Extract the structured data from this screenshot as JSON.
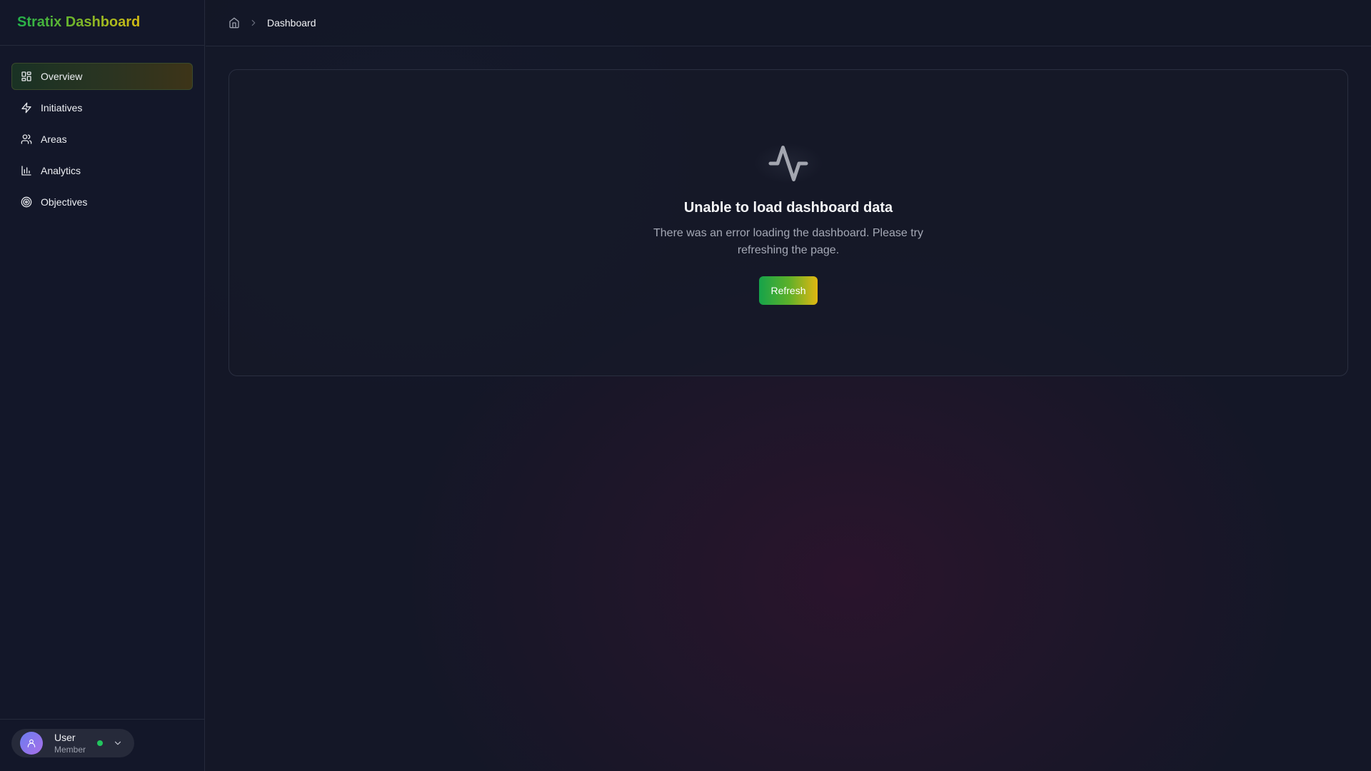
{
  "app": {
    "title": "Stratix Dashboard"
  },
  "sidebar": {
    "items": [
      {
        "label": "Overview",
        "icon": "layout-grid-icon",
        "active": true
      },
      {
        "label": "Initiatives",
        "icon": "zap-icon",
        "active": false
      },
      {
        "label": "Areas",
        "icon": "users-icon",
        "active": false
      },
      {
        "label": "Analytics",
        "icon": "bar-chart-icon",
        "active": false
      },
      {
        "label": "Objectives",
        "icon": "target-icon",
        "active": false
      }
    ]
  },
  "user": {
    "name": "User",
    "role": "Member",
    "status_color": "#22c55e"
  },
  "breadcrumb": {
    "home_icon": "home-icon",
    "current": "Dashboard"
  },
  "error": {
    "icon": "activity-icon",
    "title": "Unable to load dashboard data",
    "message": "There was an error loading the dashboard. Please try refreshing the page.",
    "button_label": "Refresh"
  },
  "colors": {
    "accent_green": "#16a34a",
    "accent_yellow": "#e2b712",
    "background": "#141727"
  }
}
